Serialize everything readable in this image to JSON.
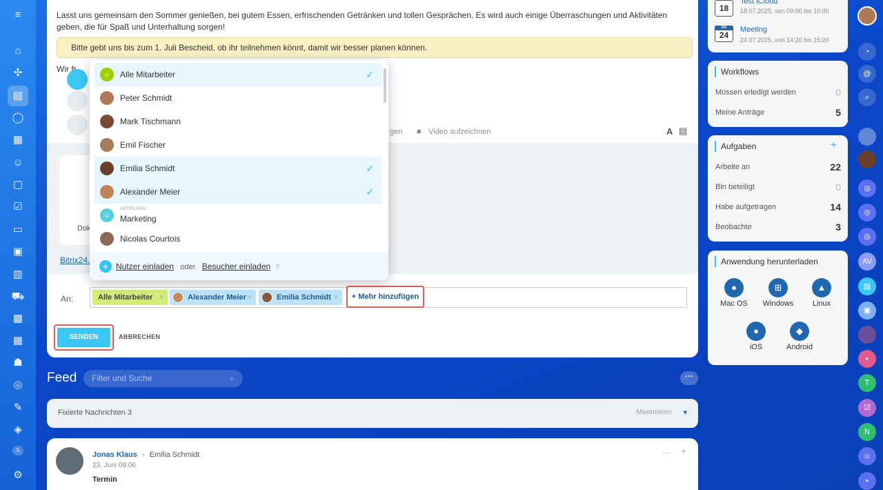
{
  "main": {
    "body_text": "Lasst uns gemeinsam den Sommer genießen, bei gutem Essen, erfrischenden Getränken und tollen Gesprächen. Es wird auch einige Überraschungen und Aktivitäten geben, die für Spaß und Unterhaltung sorgen!",
    "note": "Bitte gebt uns bis zum 1. Juli Bescheid, ob ihr teilnehmen könnt, damit wir besser planen können.",
    "partial_text": "Wir fr",
    "toolbar_partial": "gen",
    "record_video": "Video aufzeichnen",
    "format_icon": "A",
    "doc_label": "Dok",
    "bitrix_link": "Bitrix24.I"
  },
  "popup": {
    "items": [
      {
        "label": "Alle Mitarbeiter",
        "selected": true
      },
      {
        "label": "Peter Schmidt",
        "selected": false
      },
      {
        "label": "Mark Tischmann",
        "selected": false
      },
      {
        "label": "Emil Fischer",
        "selected": false
      },
      {
        "label": "Emilia Schmidt",
        "selected": true
      },
      {
        "label": "Alexander Meier",
        "selected": true
      },
      {
        "label": "Marketing",
        "sublabel": "ABTEILUNG",
        "selected": false
      },
      {
        "label": "Nicolas Courtois",
        "selected": false
      }
    ],
    "invite_users": "Nutzer einladen",
    "or": "oder",
    "invite_guests": "Besucher einladen"
  },
  "form": {
    "to_label": "An:",
    "chips": [
      "Alle Mitarbeiter",
      "Alexander Meier",
      "Emilia Schmidt"
    ],
    "add_more": "+ Mehr hinzufügen",
    "send": "SENDEN",
    "cancel": "ABBRECHEN"
  },
  "feed": {
    "title": "Feed",
    "search_placeholder": "Filter und Suche",
    "pinned_label": "Fixierte Nachrichten 3",
    "maximize": "Maximieren",
    "post": {
      "author": "Jonas Klaus",
      "recipient": "Emilia Schmidt",
      "date": "23. Juni 09:06",
      "title": "Termin"
    }
  },
  "calendar": {
    "events": [
      {
        "day": "18",
        "title": "Test iCloud",
        "time": "18.07.2025, von 09:00 bis 10:00"
      },
      {
        "day": "24",
        "dow": "DO",
        "title": "Meeting",
        "time": "24.07.2025, von 14:20 bis 15:20"
      }
    ]
  },
  "workflows": {
    "title": "Workflows",
    "rows": [
      {
        "label": "Müssen erledigt werden",
        "value": "0"
      },
      {
        "label": "Meine Anträge",
        "value": "5"
      }
    ]
  },
  "tasks": {
    "title": "Aufgaben",
    "add": "+",
    "rows": [
      {
        "label": "Arbeite an",
        "value": "22"
      },
      {
        "label": "Bin beteiligt",
        "value": "0"
      },
      {
        "label": "Habe aufgetragen",
        "value": "14"
      },
      {
        "label": "Beobachte",
        "value": "3"
      }
    ]
  },
  "apps": {
    "title": "Anwendung herunterladen",
    "items": [
      "Mac OS",
      "Windows",
      "Linux",
      "iOS",
      "Android"
    ]
  },
  "right_rail": {
    "av_initials": "AV",
    "t_initial": "T",
    "n_initial": "N"
  },
  "left_rail": {
    "s_badge": "S"
  },
  "colors": {
    "accent": "#2fc6f6",
    "highlight_border": "#e05b5b",
    "note_bg": "#f9f1c4"
  }
}
